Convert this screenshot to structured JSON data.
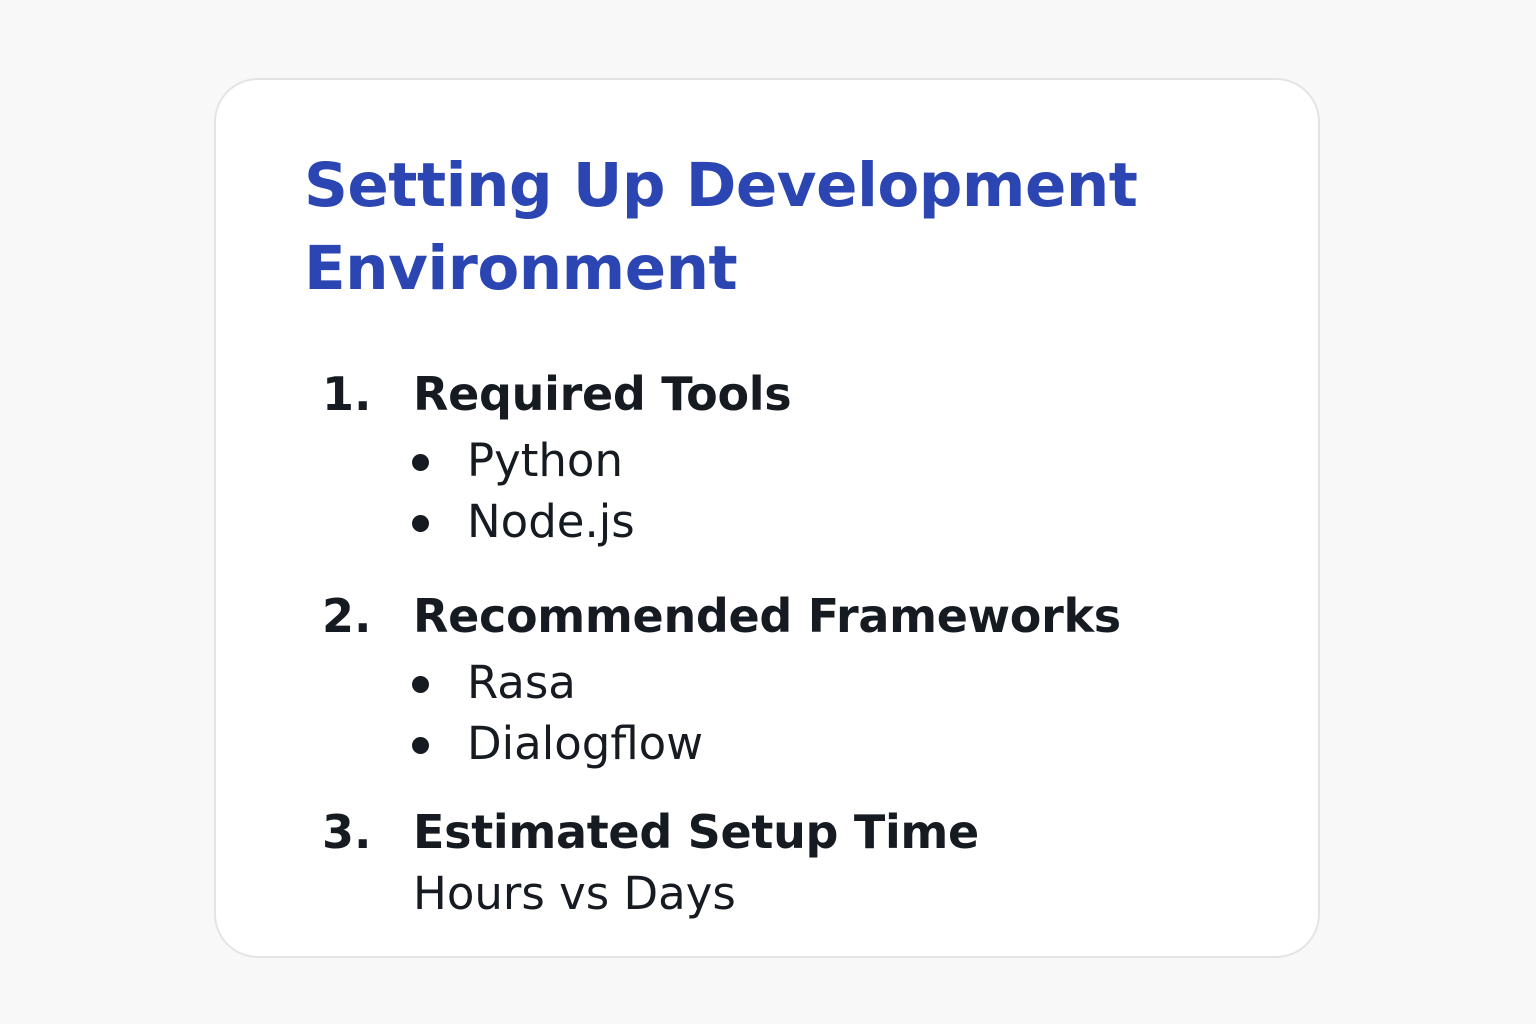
{
  "title": "Setting Up Development Environment",
  "sections": [
    {
      "number": "1.",
      "heading": "Required Tools",
      "items": [
        "Python",
        "Node.js"
      ]
    },
    {
      "number": "2.",
      "heading": "Recommended Frameworks",
      "items": [
        "Rasa",
        "Dialogflow"
      ]
    },
    {
      "number": "3.",
      "heading": "Estimated Setup Time",
      "note": "Hours vs Days"
    }
  ],
  "colors": {
    "title": "#2b45b3",
    "text": "#161b22",
    "background": "#f8f8f9",
    "card": "#ffffff"
  }
}
